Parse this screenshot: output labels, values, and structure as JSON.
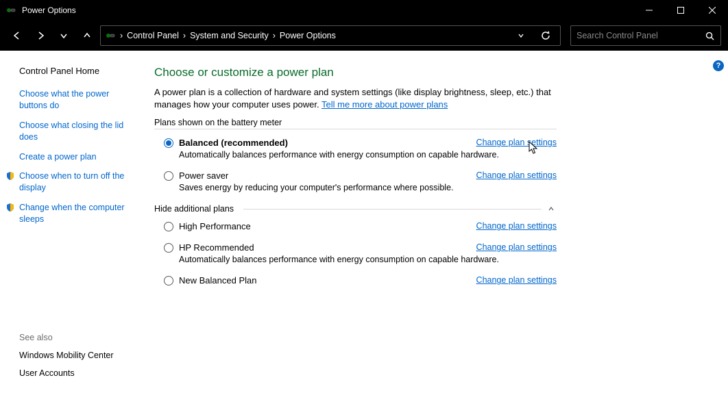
{
  "titlebar": {
    "title": "Power Options"
  },
  "breadcrumbs": {
    "b0": "Control Panel",
    "b1": "System and Security",
    "b2": "Power Options"
  },
  "search": {
    "placeholder": "Search Control Panel"
  },
  "sidebar": {
    "home": "Control Panel Home",
    "links": {
      "l0": "Choose what the power buttons do",
      "l1": "Choose what closing the lid does",
      "l2": "Create a power plan",
      "l3": "Choose when to turn off the display",
      "l4": "Change when the computer sleeps"
    },
    "seealso_label": "See also",
    "seealso": {
      "s0": "Windows Mobility Center",
      "s1": "User Accounts"
    }
  },
  "main": {
    "title": "Choose or customize a power plan",
    "desc": "A power plan is a collection of hardware and system settings (like display brightness, sleep, etc.) that manages how your computer uses power. ",
    "desc_link": "Tell me more about power plans",
    "section_battery": "Plans shown on the battery meter",
    "section_hide": "Hide additional plans",
    "change_link": "Change plan settings",
    "plans": {
      "p0": {
        "name": "Balanced (recommended)",
        "desc": "Automatically balances performance with energy consumption on capable hardware."
      },
      "p1": {
        "name": "Power saver",
        "desc": "Saves energy by reducing your computer's performance where possible."
      },
      "p2": {
        "name": "High Performance",
        "desc": ""
      },
      "p3": {
        "name": "HP Recommended",
        "desc": "Automatically balances performance with energy consumption on capable hardware."
      },
      "p4": {
        "name": "New Balanced Plan",
        "desc": ""
      }
    }
  },
  "help_badge": "?"
}
